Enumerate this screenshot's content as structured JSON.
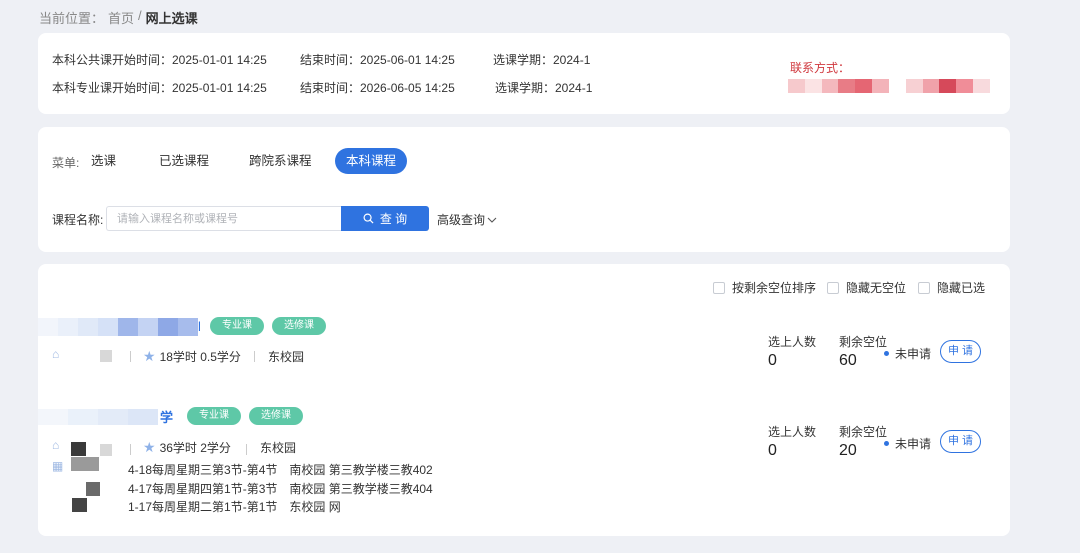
{
  "breadcrumb": {
    "label": "当前位置：",
    "home": "首页",
    "divider": "/",
    "current": "网上选课"
  },
  "schedule_info": {
    "row1": {
      "public_start": "本科公共课开始时间：2025-01-01 14:25",
      "end": "结束时间：2025-06-01 14:25",
      "term": "选课学期：2024-1"
    },
    "row2": {
      "major_start": "本科专业课开始时间：2025-01-01 14:25",
      "end": "结束时间：2026-06-05 14:25",
      "term": "选课学期：2024-1"
    },
    "contact_label": "联系方式："
  },
  "menu": {
    "label": "菜单:",
    "items": [
      "选课",
      "已选课程",
      "跨院系课程",
      "本科课程"
    ],
    "active_index": 3
  },
  "search": {
    "label": "课程名称:",
    "placeholder": "请输入课程名称或课程号",
    "button": "查 询",
    "advanced": "高级查询"
  },
  "filters": [
    "按剩余空位排序",
    "隐藏无空位",
    "隐藏已选"
  ],
  "courses": [
    {
      "title_suffix": "l",
      "tags": [
        "专业课",
        "选修课"
      ],
      "hours_credits": "18学时 0.5学分",
      "campus": "东校园",
      "selected_label": "选上人数",
      "selected": "0",
      "remaining_label": "剩余空位",
      "remaining": "60",
      "status": "未申请",
      "apply": "申 请"
    },
    {
      "title_suffix": "学",
      "tags": [
        "专业课",
        "选修课"
      ],
      "hours_credits": "36学时 2学分",
      "campus": "东校园",
      "selected_label": "选上人数",
      "selected": "0",
      "remaining_label": "剩余空位",
      "remaining": "20",
      "status": "未申请",
      "apply": "申 请",
      "sessions": [
        "4-18每周星期三第3节-第4节　南校园 第三教学楼三教402",
        "4-17每周星期四第1节-第3节　南校园 第三教学楼三教404",
        "1-17每周星期二第1节-第1节　东校园 网"
      ]
    }
  ],
  "colors": {
    "primary": "#2f73e0",
    "tag": "#5ec8a7",
    "contact": "#d0383e",
    "background": "#eef0f5"
  }
}
